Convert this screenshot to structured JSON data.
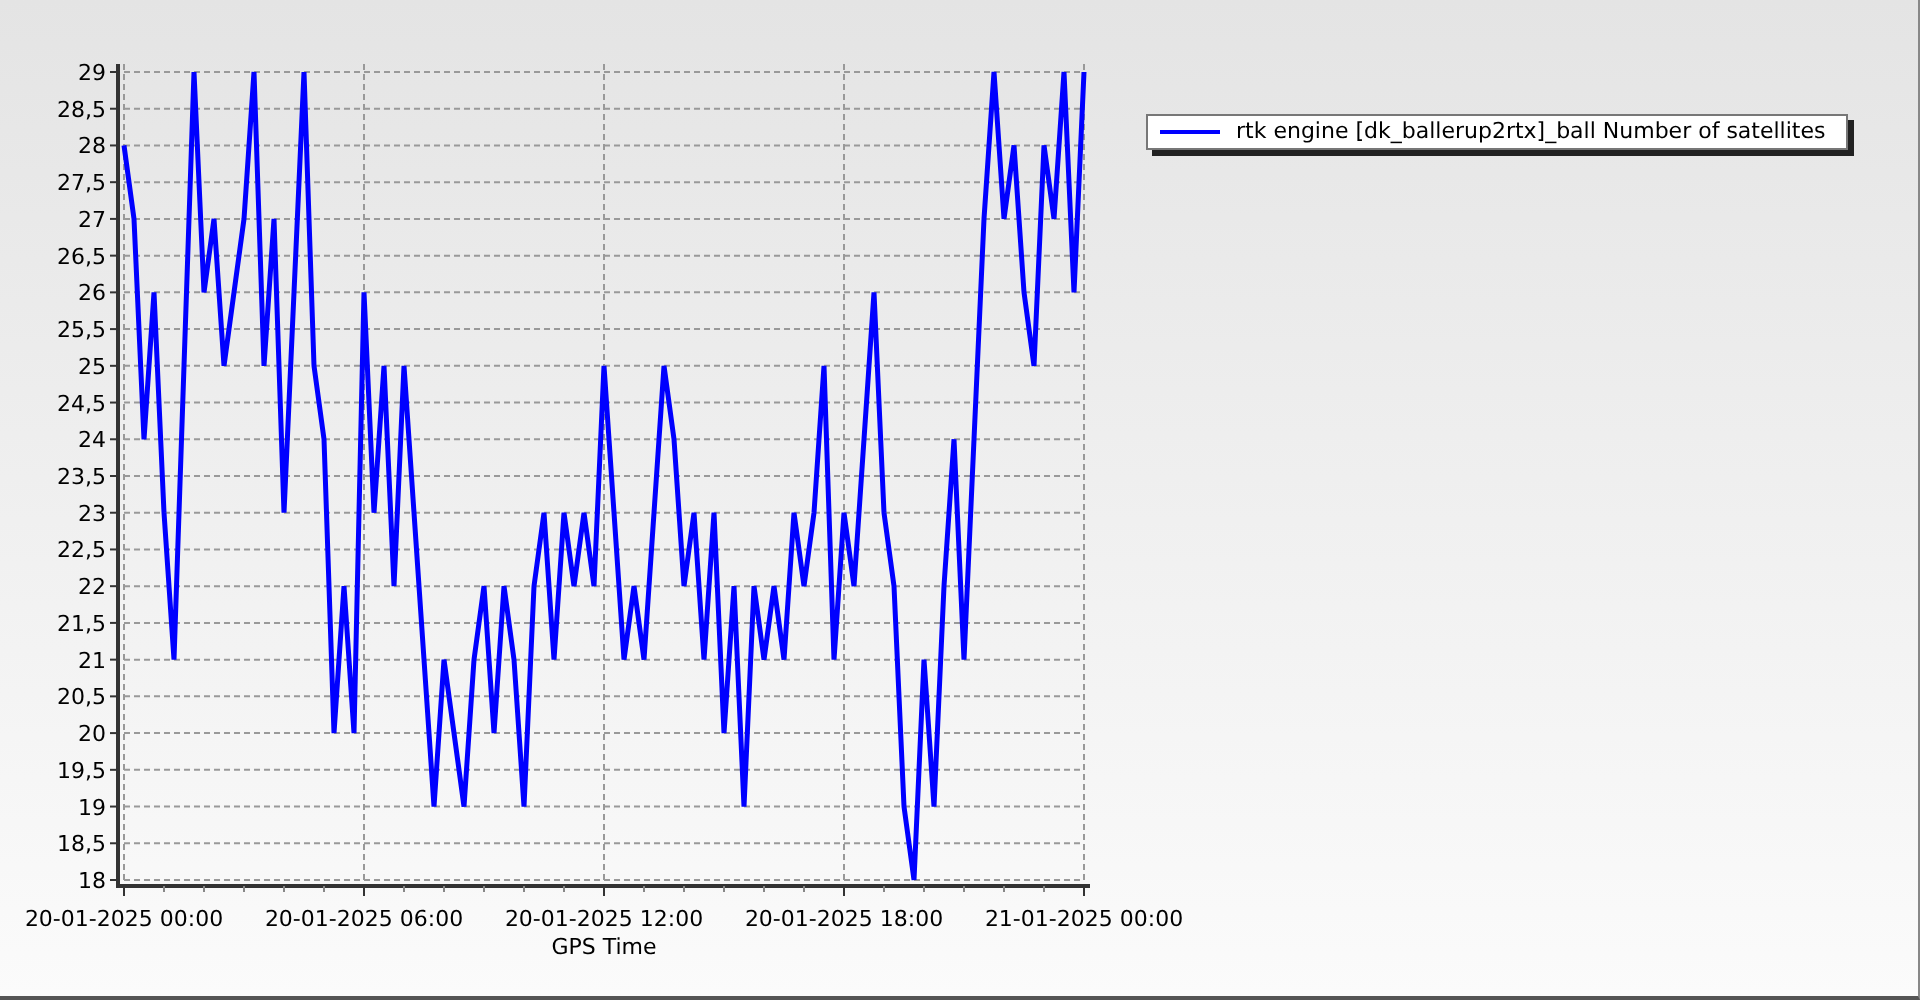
{
  "chart_data": {
    "type": "line",
    "grid": true,
    "xlabel": "GPS Time",
    "categories": [
      "20-01-2025 00:00",
      null,
      null,
      null,
      null,
      null,
      null,
      null,
      null,
      null,
      null,
      null,
      null,
      null,
      null,
      null,
      null,
      null,
      null,
      null,
      null,
      null,
      null,
      null,
      "20-01-2025 06:00",
      null,
      null,
      null,
      null,
      null,
      null,
      null,
      null,
      null,
      null,
      null,
      null,
      null,
      null,
      null,
      null,
      null,
      null,
      null,
      null,
      null,
      null,
      null,
      "20-01-2025 12:00",
      null,
      null,
      null,
      null,
      null,
      null,
      null,
      null,
      null,
      null,
      null,
      null,
      null,
      null,
      null,
      null,
      null,
      null,
      null,
      null,
      null,
      null,
      null,
      "20-01-2025 18:00",
      null,
      null,
      null,
      null,
      null,
      null,
      null,
      null,
      null,
      null,
      null,
      null,
      null,
      null,
      null,
      null,
      null,
      null,
      null,
      null,
      null,
      null,
      null,
      "21-01-2025 00:00"
    ],
    "series": [
      {
        "name": "rtk engine [dk_ballerup2rtx]_ball Number of satellites",
        "color": "#0000ff",
        "values": [
          28,
          27,
          24,
          26,
          23,
          21,
          25,
          29,
          26,
          27,
          25,
          26,
          27,
          29,
          25,
          27,
          23,
          26,
          29,
          25,
          24,
          20,
          22,
          20,
          26,
          23,
          25,
          22,
          25,
          23,
          21,
          19,
          21,
          20,
          19,
          21,
          22,
          20,
          22,
          21,
          19,
          22,
          23,
          21,
          23,
          22,
          23,
          22,
          25,
          23,
          21,
          22,
          21,
          23,
          25,
          24,
          22,
          23,
          21,
          23,
          20,
          22,
          19,
          22,
          21,
          22,
          21,
          23,
          22,
          23,
          25,
          21,
          23,
          22,
          24,
          26,
          23,
          22,
          19,
          18,
          21,
          19,
          22,
          24,
          21,
          24,
          27,
          29,
          27,
          28,
          26,
          25,
          28,
          27,
          29,
          26,
          29
        ]
      }
    ],
    "ylim": [
      18,
      29
    ],
    "yticks": [
      18,
      {
        "value": 18.5,
        "label": "18,5"
      },
      19,
      {
        "value": 19.5,
        "label": "19,5"
      },
      20,
      {
        "value": 20.5,
        "label": "20,5"
      },
      21,
      {
        "value": 21.5,
        "label": "21,5"
      },
      22,
      {
        "value": 22.5,
        "label": "22,5"
      },
      23,
      {
        "value": 23.5,
        "label": "23,5"
      },
      24,
      {
        "value": 24.5,
        "label": "24,5"
      },
      25,
      {
        "value": 25.5,
        "label": "25,5"
      },
      26,
      {
        "value": 26.5,
        "label": "26,5"
      },
      27,
      {
        "value": 27.5,
        "label": "27,5"
      },
      28,
      {
        "value": 28.5,
        "label": "28,5"
      },
      29
    ]
  }
}
